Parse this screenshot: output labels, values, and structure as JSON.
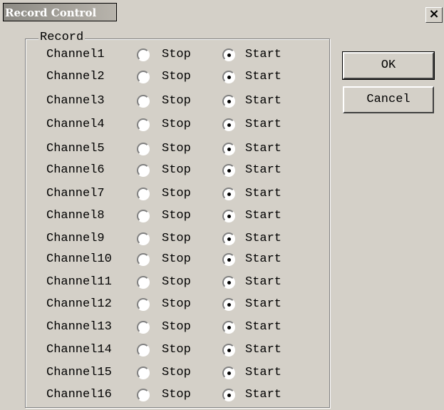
{
  "window": {
    "title": "Record Control",
    "close_label": "×"
  },
  "group": {
    "label": "Record"
  },
  "options": {
    "stop_label": "Stop",
    "start_label": "Start"
  },
  "channels": [
    {
      "name": "Channel1",
      "state": "start"
    },
    {
      "name": "Channel2",
      "state": "start"
    },
    {
      "name": "Channel3",
      "state": "start"
    },
    {
      "name": "Channel4",
      "state": "start"
    },
    {
      "name": "Channel5",
      "state": "start"
    },
    {
      "name": "Channel6",
      "state": "start"
    },
    {
      "name": "Channel7",
      "state": "start"
    },
    {
      "name": "Channel8",
      "state": "start"
    },
    {
      "name": "Channel9",
      "state": "start"
    },
    {
      "name": "Channel10",
      "state": "start"
    },
    {
      "name": "Channel11",
      "state": "start"
    },
    {
      "name": "Channel12",
      "state": "start"
    },
    {
      "name": "Channel13",
      "state": "start"
    },
    {
      "name": "Channel14",
      "state": "start"
    },
    {
      "name": "Channel15",
      "state": "start"
    },
    {
      "name": "Channel16",
      "state": "start"
    }
  ],
  "buttons": {
    "ok_label": "OK",
    "cancel_label": "Cancel"
  }
}
